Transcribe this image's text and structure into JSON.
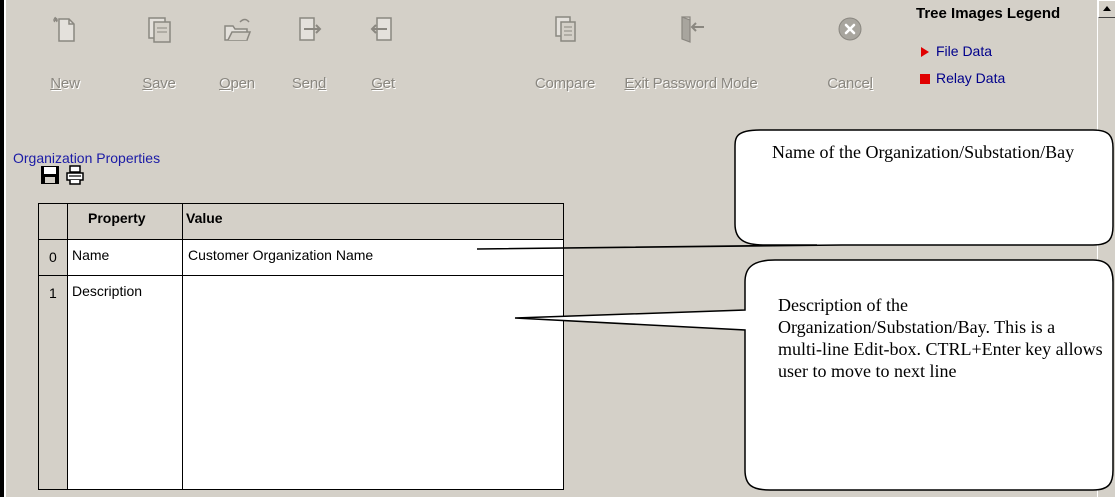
{
  "toolbar": {
    "buttons": [
      {
        "id": "new",
        "pre": "",
        "u": "N",
        "post": "ew",
        "icon": "new-icon"
      },
      {
        "id": "save",
        "pre": "",
        "u": "S",
        "post": "ave",
        "icon": "save-icon"
      },
      {
        "id": "open",
        "pre": "",
        "u": "O",
        "post": "pen",
        "icon": "open-folder-icon"
      },
      {
        "id": "send",
        "pre": "Sen",
        "u": "d",
        "post": "",
        "icon": "send-icon"
      },
      {
        "id": "get",
        "pre": "",
        "u": "G",
        "post": "et",
        "icon": "get-icon"
      },
      {
        "id": "compare",
        "pre": "Compare",
        "u": "",
        "post": "",
        "icon": "compare-icon"
      },
      {
        "id": "exit_password_mode",
        "pre": "",
        "u": "E",
        "post": "xit Password Mode",
        "icon": "exit-door-icon"
      },
      {
        "id": "cancel",
        "pre": "Cance",
        "u": "l",
        "post": "",
        "icon": "cancel-icon"
      }
    ]
  },
  "legend": {
    "title": "Tree Images Legend",
    "items": [
      {
        "label": "File Data",
        "marker": "triangle",
        "color": "#e00000"
      },
      {
        "label": "Relay Data",
        "marker": "square",
        "color": "#e00000"
      }
    ]
  },
  "section_title": "Organization Properties",
  "grid": {
    "headers": {
      "property": "Property",
      "value": "Value"
    },
    "rows": [
      {
        "index": "0",
        "property": "Name",
        "value": "Customer Organization Name"
      },
      {
        "index": "1",
        "property": "Description",
        "value": ""
      }
    ]
  },
  "callouts": {
    "name": "Name of the Organization/Substation/Bay",
    "description": "Description of the Organization/Substation/Bay. This is a multi-line Edit-box. CTRL+Enter key allows user to move to next line"
  },
  "colors": {
    "background": "#d4d0c8",
    "link_blue": "#1a1aa6",
    "disabled_text": "#8a8780",
    "legend_marker": "#e00000"
  }
}
